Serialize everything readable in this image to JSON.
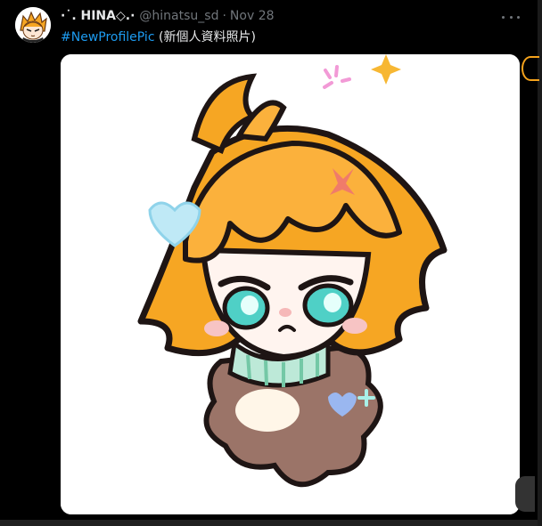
{
  "tweet": {
    "author_name": "·˙. HINA◇.·",
    "handle": "@hinatsu_sd",
    "separator": "·",
    "date": "Nov 28",
    "hashtag": "#NewProfilePic",
    "text_suffix": " (新個人資料照片)"
  },
  "icons": {
    "more": "more-horizontal-icon"
  },
  "colors": {
    "background": "#000000",
    "text_primary": "#e7e9ea",
    "text_secondary": "#71767b",
    "link": "#1d9bf0"
  }
}
